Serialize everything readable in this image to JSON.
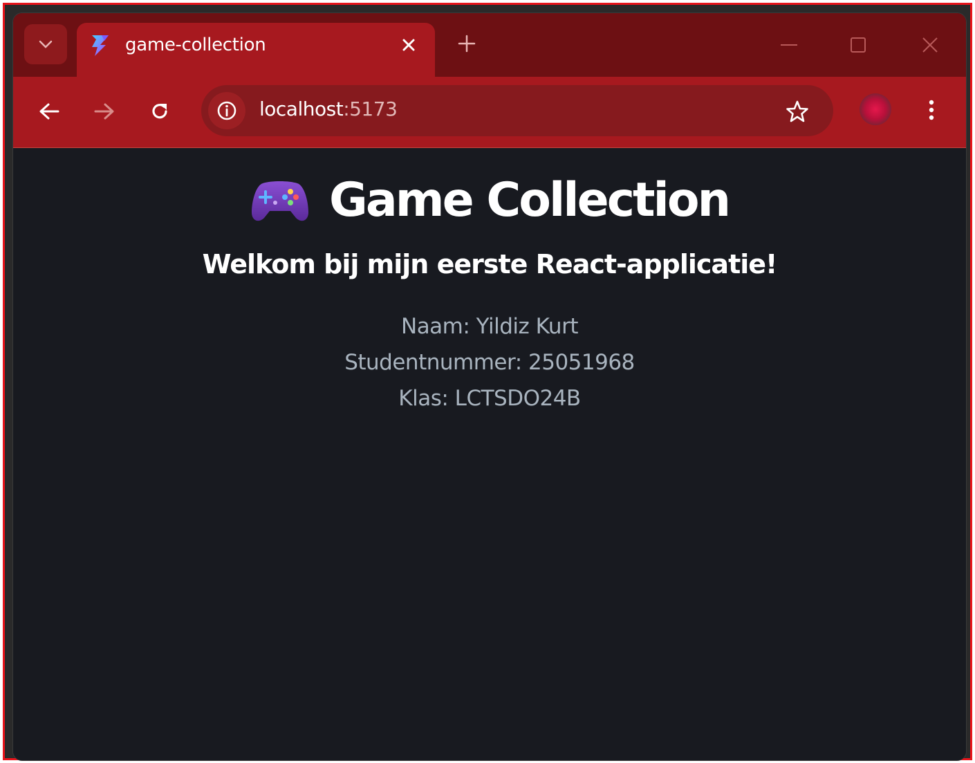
{
  "browser": {
    "tab": {
      "title": "game-collection",
      "favicon": "vite-icon"
    },
    "address_bar": {
      "host": "localhost",
      "port": ":5173"
    },
    "colors": {
      "tabstrip": "#6d1013",
      "toolbar": "#a7191f",
      "omnibox": "#861a1e"
    }
  },
  "page": {
    "title": "Game Collection",
    "title_icon": "gamepad-icon",
    "subtitle": "Welkom bij mijn eerste React-applicatie!",
    "details": {
      "name": "Naam: Yildiz Kurt",
      "student_number": "Studentnummer: 25051968",
      "class": "Klas: LCTSDO24B"
    },
    "colors": {
      "background": "#181a20",
      "heading": "#ffffff",
      "details": "#a9b4bf"
    }
  }
}
